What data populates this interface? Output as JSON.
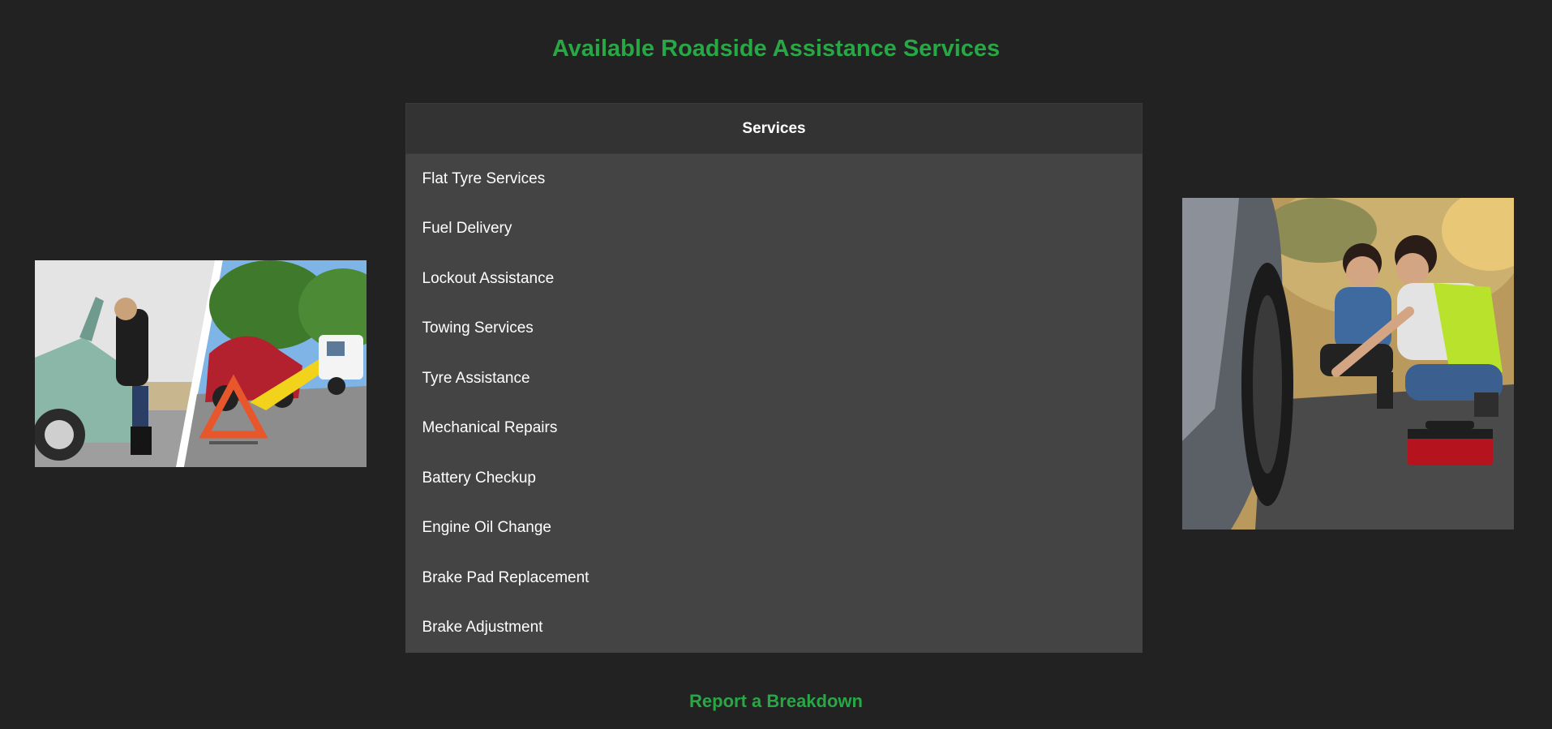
{
  "page": {
    "title": "Available Roadside Assistance Services",
    "accent_color": "#28a745",
    "background_color": "#222222"
  },
  "services_table": {
    "header": "Services",
    "rows": [
      "Flat Tyre Services",
      "Fuel Delivery",
      "Lockout Assistance",
      "Towing Services",
      "Tyre Assistance",
      "Mechanical Repairs",
      "Battery Checkup",
      "Engine Oil Change",
      "Brake Pad Replacement",
      "Brake Adjustment"
    ]
  },
  "images": {
    "left": "breakdown-collage-photo",
    "right": "tyre-repair-photo"
  },
  "footer": {
    "report_link": "Report a Breakdown"
  }
}
